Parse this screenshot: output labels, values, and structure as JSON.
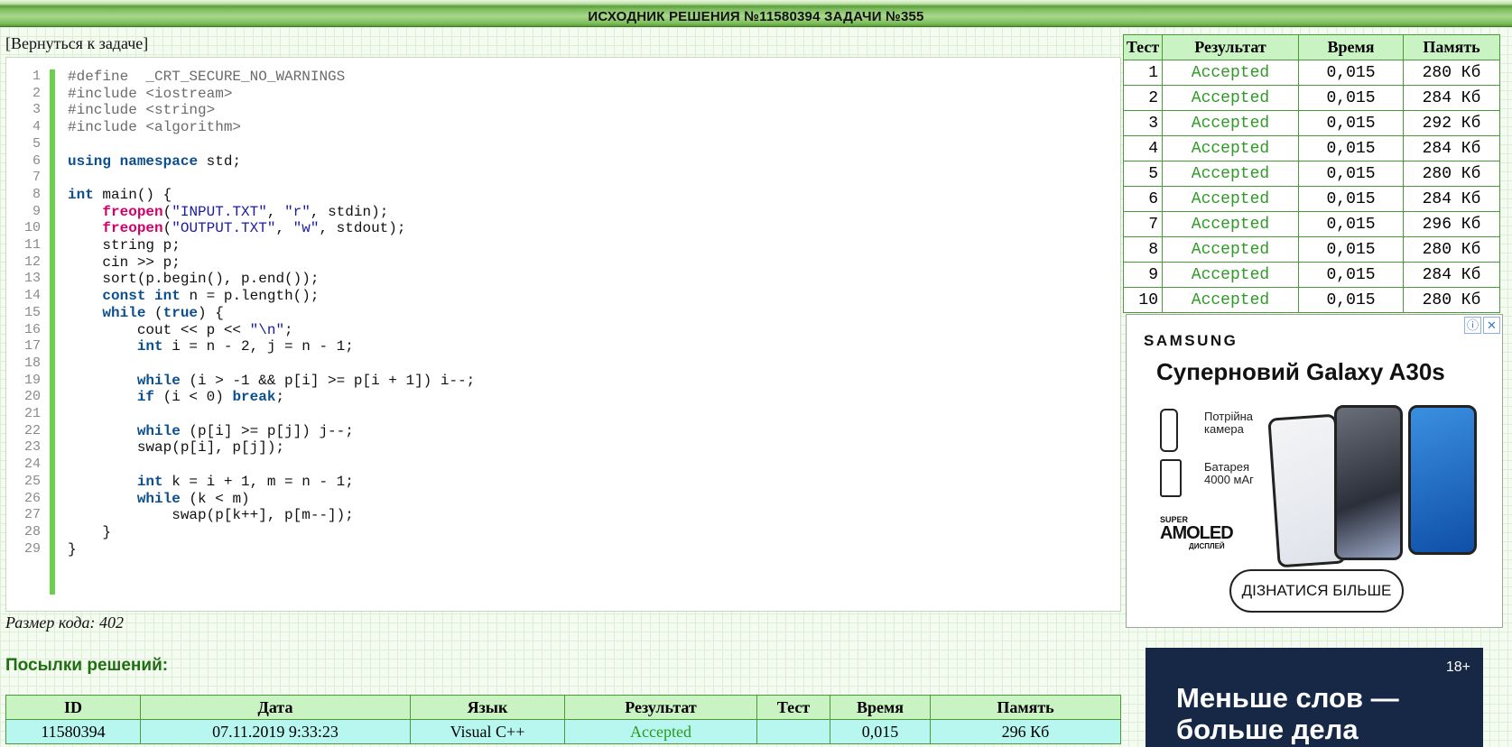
{
  "header": {
    "title": "ИСХОДНИК РЕШЕНИЯ №11580394 ЗАДАЧИ №355"
  },
  "back_link": "[Вернуться к задаче]",
  "code": {
    "lines": [
      "#define  _CRT_SECURE_NO_WARNINGS",
      "#include <iostream>",
      "#include <string>",
      "#include <algorithm>",
      "",
      "using namespace std;",
      "",
      "int main() {",
      "    freopen(\"INPUT.TXT\", \"r\", stdin);",
      "    freopen(\"OUTPUT.TXT\", \"w\", stdout);",
      "    string p;",
      "    cin >> p;",
      "    sort(p.begin(), p.end());",
      "    const int n = p.length();",
      "    while (true) {",
      "        cout << p << \"\\n\";",
      "        int i = n - 2, j = n - 1;",
      "",
      "        while (i > -1 && p[i] >= p[i + 1]) i--;",
      "        if (i < 0) break;",
      "",
      "        while (p[i] >= p[j]) j--;",
      "        swap(p[i], p[j]);",
      "",
      "        int k = i + 1, m = n - 1;",
      "        while (k < m)",
      "            swap(p[k++], p[m--]);",
      "    }",
      "}"
    ],
    "size_label": "Размер кода: 402"
  },
  "submissions": {
    "title": "Посылки решений:",
    "columns": [
      "ID",
      "Дата",
      "Язык",
      "Результат",
      "Тест",
      "Время",
      "Память"
    ],
    "rows": [
      {
        "id": "11580394",
        "date": "07.11.2019 9:33:23",
        "lang": "Visual C++",
        "result": "Accepted",
        "test": "",
        "time": "0,015",
        "memory": "296 Кб"
      }
    ]
  },
  "tests": {
    "columns": [
      "Тест",
      "Результат",
      "Время",
      "Память"
    ],
    "rows": [
      {
        "test": "1",
        "result": "Accepted",
        "time": "0,015",
        "memory": "280 Кб"
      },
      {
        "test": "2",
        "result": "Accepted",
        "time": "0,015",
        "memory": "284 Кб"
      },
      {
        "test": "3",
        "result": "Accepted",
        "time": "0,015",
        "memory": "292 Кб"
      },
      {
        "test": "4",
        "result": "Accepted",
        "time": "0,015",
        "memory": "284 Кб"
      },
      {
        "test": "5",
        "result": "Accepted",
        "time": "0,015",
        "memory": "280 Кб"
      },
      {
        "test": "6",
        "result": "Accepted",
        "time": "0,015",
        "memory": "284 Кб"
      },
      {
        "test": "7",
        "result": "Accepted",
        "time": "0,015",
        "memory": "296 Кб"
      },
      {
        "test": "8",
        "result": "Accepted",
        "time": "0,015",
        "memory": "280 Кб"
      },
      {
        "test": "9",
        "result": "Accepted",
        "time": "0,015",
        "memory": "284 Кб"
      },
      {
        "test": "10",
        "result": "Accepted",
        "time": "0,015",
        "memory": "280 Кб"
      }
    ]
  },
  "ad_samsung": {
    "brand": "SAMSUNG",
    "headline": "Суперновий Galaxy A30s",
    "feature_camera": "Потрійна\nкамера",
    "feature_battery": "Батарея\n4000 мАг",
    "feature_display_top": "SUPER",
    "feature_display": "AMOLED",
    "feature_display_sub": "ДИСПЛЕЙ",
    "cta": "ДІЗНАТИСЯ БІЛЬШЕ",
    "info_icon": "info-icon",
    "close_icon": "close-icon"
  },
  "ad_second": {
    "age": "18+",
    "slogan": "Меньше слов —\nбольше дела"
  }
}
